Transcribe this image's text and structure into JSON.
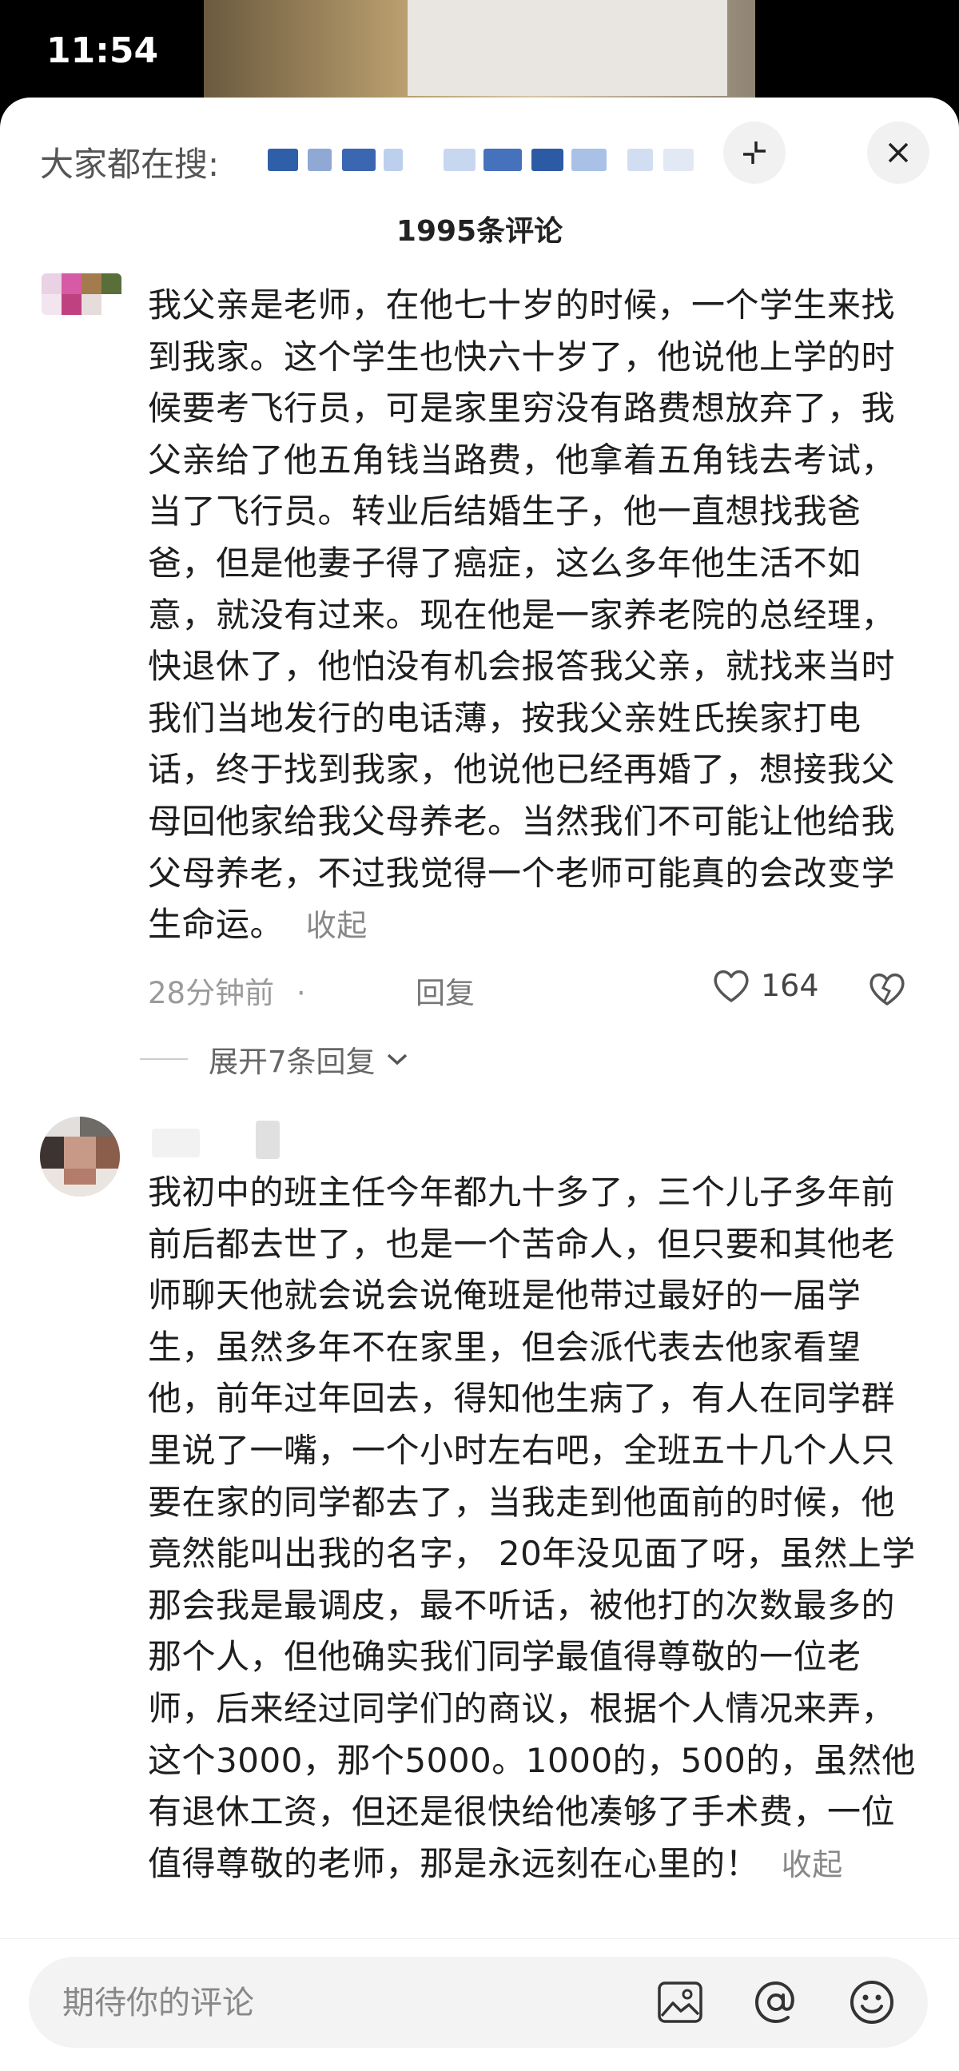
{
  "status_bar": {
    "time": "11:54"
  },
  "search": {
    "label": "大家都在搜:"
  },
  "header": {
    "title": "1995条评论"
  },
  "comments": [
    {
      "text": "我父亲是老师，在他七十岁的时候，一个学生来找到我家。这个学生也快六十岁了，他说他上学的时候要考飞行员，可是家里穷没有路费想放弃了，我父亲给了他五角钱当路费，他拿着五角钱去考试，当了飞行员。转业后结婚生子，他一直想找我爸爸，但是他妻子得了癌症，这么多年他生活不如意，就没有过来。现在他是一家养老院的总经理，快退休了，他怕没有机会报答我父亲，就找来当时我们当地发行的电话薄，按我父亲姓氏挨家打电话，终于找到我家，他说他已经再婚了，想接我父母回他家给我父母养老。当然我们不可能让他给我父母养老，不过我觉得一个老师可能真的会改变学生命运。",
      "collapse": "收起",
      "time": "28分钟前",
      "separator": "·",
      "reply": "回复",
      "likes": "164",
      "expand_replies": "展开7条回复"
    },
    {
      "text": "我初中的班主任今年都九十多了，三个儿子多年前前后都去世了，也是一个苦命人，但只要和其他老师聊天他就会说会说俺班是他带过最好的一届学生，虽然多年不在家里，但会派代表去他家看望他，前年过年回去，得知他生病了，有人在同学群里说了一嘴，一个小时左右吧，全班五十几个人只要在家的同学都去了，当我走到他面前的时候，他竟然能叫出我的名字， 20年没见面了呀，虽然上学那会我是最调皮，最不听话，被他打的次数最多的那个人，但他确实我们同学最值得尊敬的一位老师，后来经过同学们的商议，根据个人情况来弄，这个3000，那个5000。1000的，500的，虽然他有退休工资，但还是很快给他凑够了手术费，一位值得尊敬的老师，那是永远刻在心里的！",
      "collapse": "收起"
    }
  ],
  "input": {
    "placeholder": "期待你的评论"
  },
  "icons": [
    "image-icon",
    "at-icon",
    "emoji-icon",
    "expand-icon",
    "close-icon",
    "heart-icon",
    "broken-heart-icon",
    "chevron-down-icon"
  ]
}
